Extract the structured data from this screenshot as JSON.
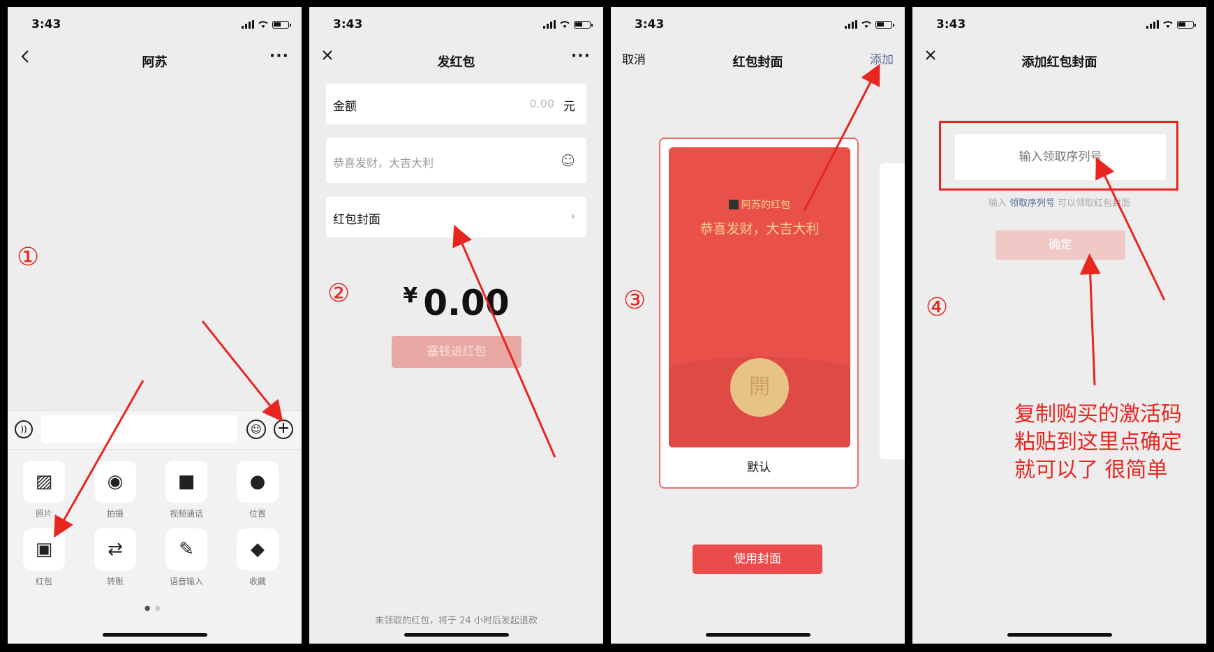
{
  "status": {
    "time": "3:43"
  },
  "panel1": {
    "title": "阿苏",
    "step": "①",
    "tray": [
      {
        "label": "照片",
        "icon": "photo-icon",
        "glyph": "▨"
      },
      {
        "label": "拍摄",
        "icon": "camera-icon",
        "glyph": "◉"
      },
      {
        "label": "视频通话",
        "icon": "video-call-icon",
        "glyph": "■"
      },
      {
        "label": "位置",
        "icon": "location-pin-icon",
        "glyph": "●"
      },
      {
        "label": "红包",
        "icon": "red-packet-icon",
        "glyph": "▣"
      },
      {
        "label": "转账",
        "icon": "transfer-icon",
        "glyph": "⇄"
      },
      {
        "label": "语音输入",
        "icon": "microphone-icon",
        "glyph": "✎"
      },
      {
        "label": "收藏",
        "icon": "favorites-cube-icon",
        "glyph": "◆"
      }
    ]
  },
  "panel2": {
    "title": "发红包",
    "step": "②",
    "amount_label": "金额",
    "amount_placeholder": "0.00",
    "amount_unit": "元",
    "blessing_placeholder": "恭喜发财，大吉大利",
    "cover_label": "红包封面",
    "total_yen": "¥",
    "total": "0.00",
    "submit_label": "塞钱进红包",
    "refund_note": "未领取的红包，将于 24 小时后发起退款"
  },
  "panel3": {
    "cancel_label": "取消",
    "title": "红包封面",
    "add_label": "添加",
    "step": "③",
    "envelope_sender": "阿苏的红包",
    "envelope_blessing": "恭喜发财，大吉大利",
    "open_glyph": "開",
    "envelope_caption": "默认",
    "use_button": "使用封面"
  },
  "panel4": {
    "title": "添加红包封面",
    "step": "④",
    "code_placeholder": "输入领取序列号",
    "hint_prefix": "输入",
    "hint_link": "领取序列号",
    "hint_suffix": "可以领取红包封面",
    "confirm_label": "确定",
    "note_line1": "复制购买的激活码",
    "note_line2": "粘贴到这里点确定",
    "note_line3": "就可以了 很简单"
  },
  "colors": {
    "annotation_red": "#e8251f",
    "wechat_red": "#ea4c4c",
    "link_blue": "#576b95"
  }
}
